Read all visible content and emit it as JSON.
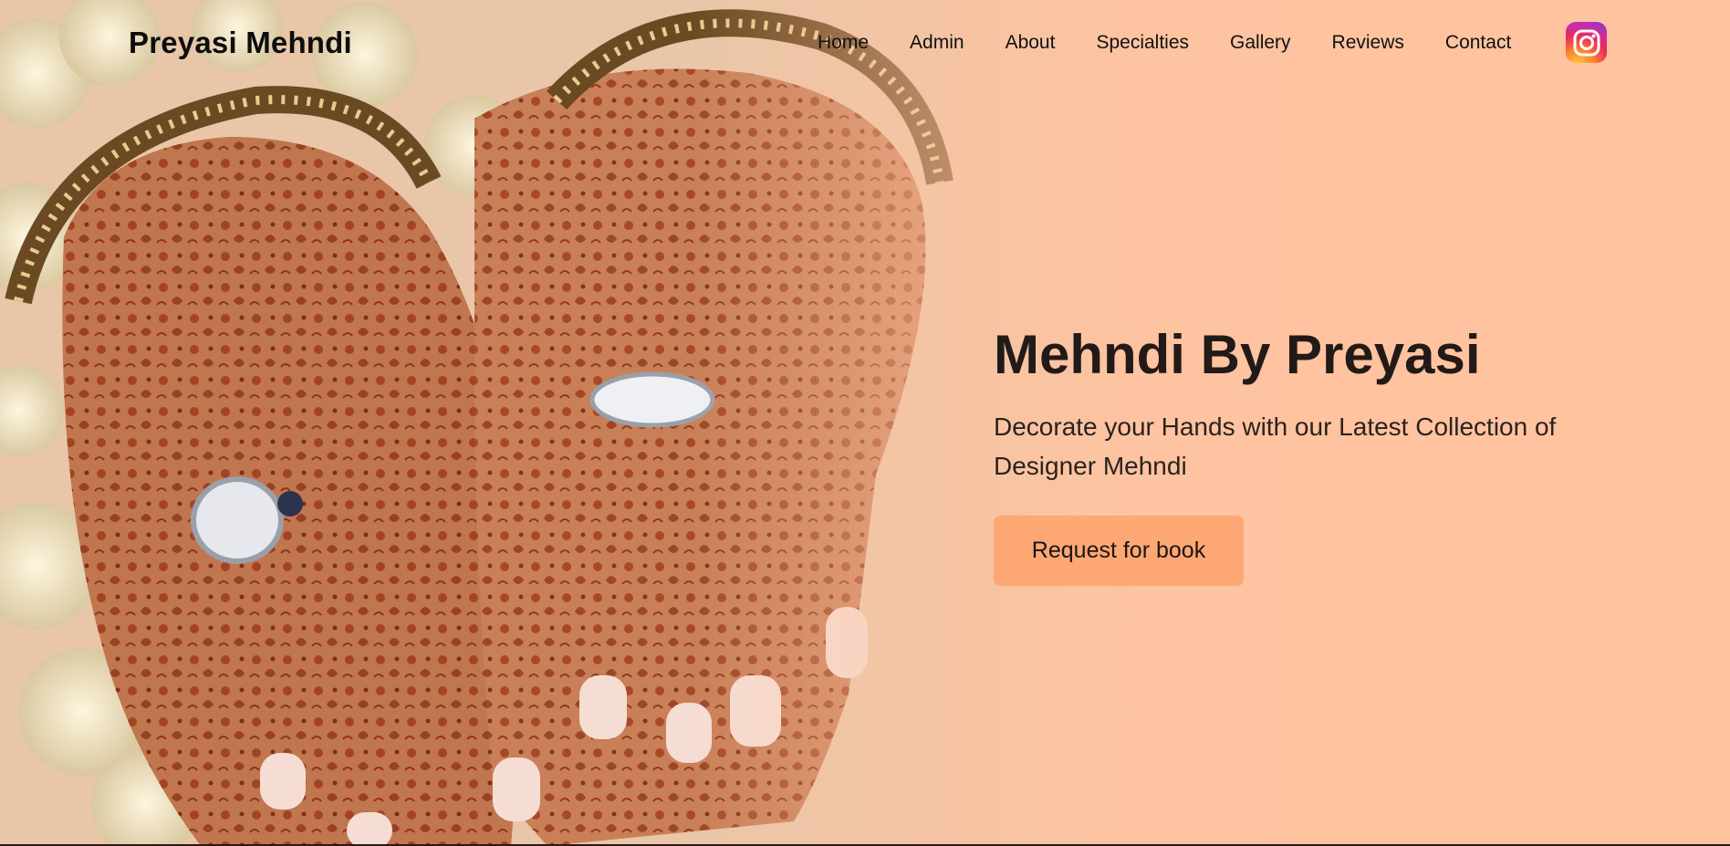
{
  "brand": {
    "name": "Preyasi Mehndi"
  },
  "nav": {
    "items": [
      {
        "label": "Home"
      },
      {
        "label": "Admin"
      },
      {
        "label": "About"
      },
      {
        "label": "Specialties"
      },
      {
        "label": "Gallery"
      },
      {
        "label": "Reviews"
      },
      {
        "label": "Contact"
      }
    ],
    "social_icon": "instagram-icon"
  },
  "hero": {
    "title": "Mehndi By Preyasi",
    "subtitle": "Decorate your Hands with our Latest Collection of Designer Mehndi",
    "cta_label": "Request for book",
    "background_image": "mehndi-hands-image"
  },
  "colors": {
    "background": "#ffc3a0",
    "button": "#fca774",
    "henna": "#8b2a12",
    "text": "#221a17"
  }
}
